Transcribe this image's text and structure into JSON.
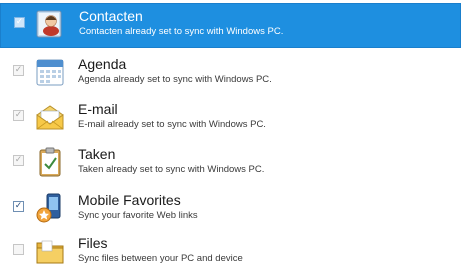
{
  "items": [
    {
      "title": "Contacten",
      "subtitle": "Contacten already set to sync with Windows PC.",
      "checked": true,
      "selected": true,
      "icon": "contacts-icon"
    },
    {
      "title": "Agenda",
      "subtitle": "Agenda already set to sync with Windows PC.",
      "checked": true,
      "selected": false,
      "icon": "calendar-icon"
    },
    {
      "title": "E-mail",
      "subtitle": "E-mail already set to sync with Windows PC.",
      "checked": true,
      "selected": false,
      "icon": "email-icon"
    },
    {
      "title": "Taken",
      "subtitle": "Taken already set to sync with Windows PC.",
      "checked": true,
      "selected": false,
      "icon": "tasks-icon"
    },
    {
      "title": "Mobile Favorites",
      "subtitle": "Sync your favorite Web links",
      "checked": true,
      "selected": false,
      "icon": "mobile-favorites-icon"
    },
    {
      "title": "Files",
      "subtitle": "Sync files between your PC and device",
      "checked": false,
      "selected": false,
      "icon": "folder-icon"
    }
  ],
  "checkmark": "✓",
  "colors": {
    "selection": "#1e8fe0",
    "text": "#1a1a1a"
  }
}
